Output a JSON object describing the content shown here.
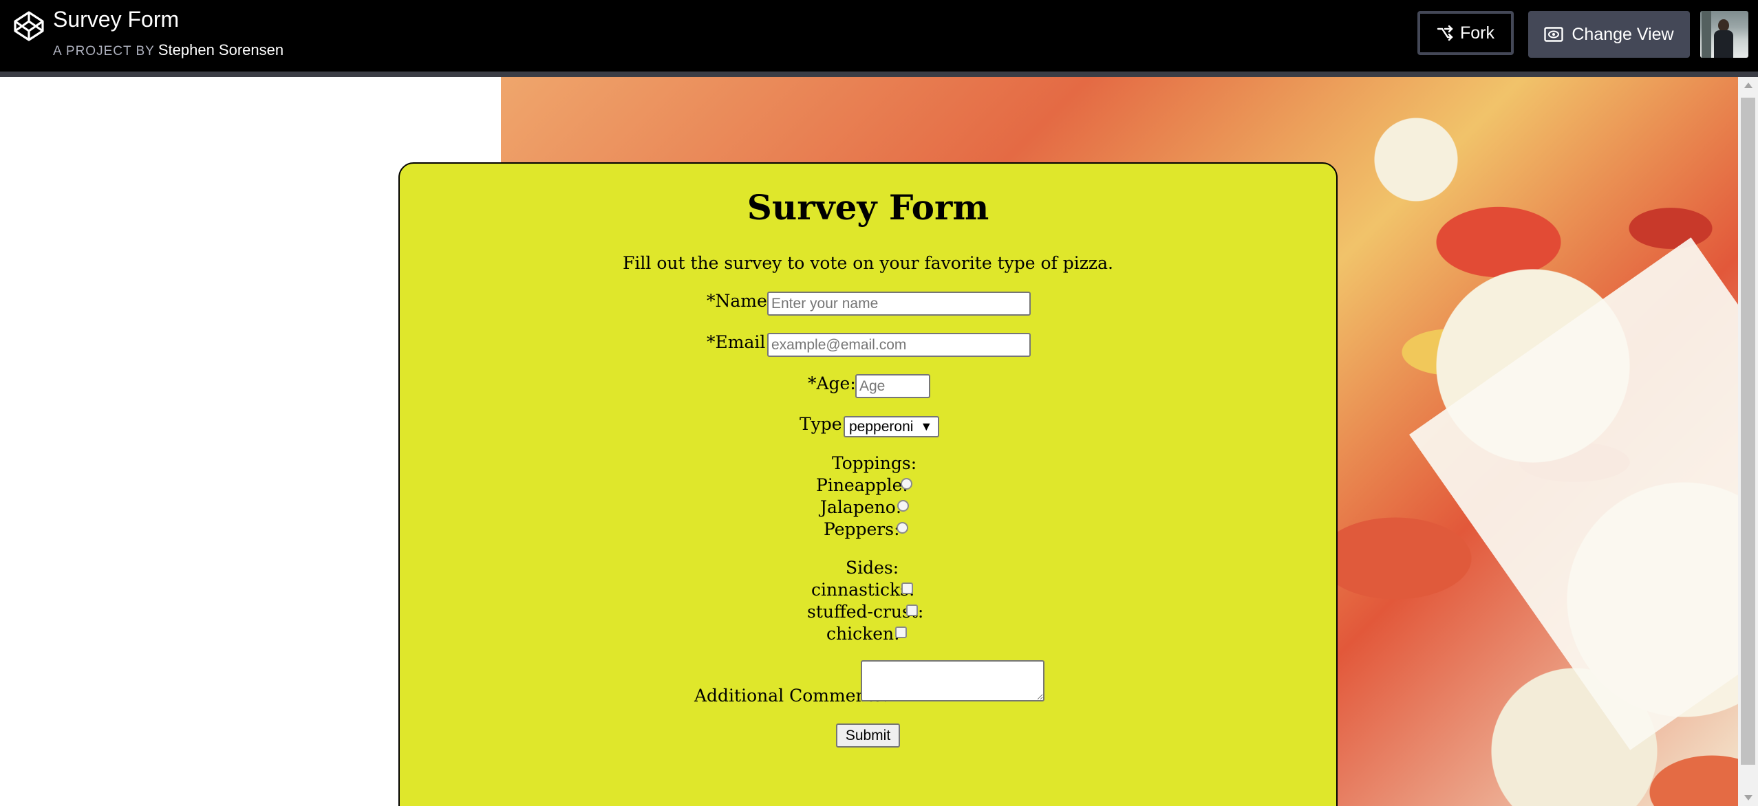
{
  "header": {
    "project_title": "Survey Form",
    "byline_prefix": "A PROJECT BY",
    "author": "Stephen Sorensen",
    "fork_label": "Fork",
    "change_view_label": "Change View"
  },
  "form": {
    "title": "Survey Form",
    "description": "Fill out the survey to vote on your favorite type of pizza.",
    "name_label": "*Name:",
    "name_placeholder": "Enter your name",
    "email_label": "*Email:",
    "email_placeholder": "example@email.com",
    "age_label": "*Age:",
    "age_placeholder": "Age",
    "type_label": "Type:",
    "type_selected": "pepperoni",
    "toppings_label": "Toppings:",
    "toppings": [
      {
        "label": "Pineapple:",
        "checked": false
      },
      {
        "label": "Jalapeno:",
        "checked": false
      },
      {
        "label": "Peppers:",
        "checked": false
      }
    ],
    "sides_label": "Sides:",
    "sides": [
      {
        "label": "cinnasticks:",
        "checked": false
      },
      {
        "label": "stuffed-crust:",
        "checked": false
      },
      {
        "label": "chicken:",
        "checked": false
      }
    ],
    "comments_label": "Additional Comments:",
    "submit_label": "Submit"
  },
  "colors": {
    "topbar_bg": "#000000",
    "card_bg": "#dfe72b",
    "button_bg": "#444857"
  },
  "icons": {
    "logo": "codepen-logo-icon",
    "fork": "fork-icon",
    "change_view": "eye-view-icon",
    "select_arrow": "triangle-down-icon"
  }
}
